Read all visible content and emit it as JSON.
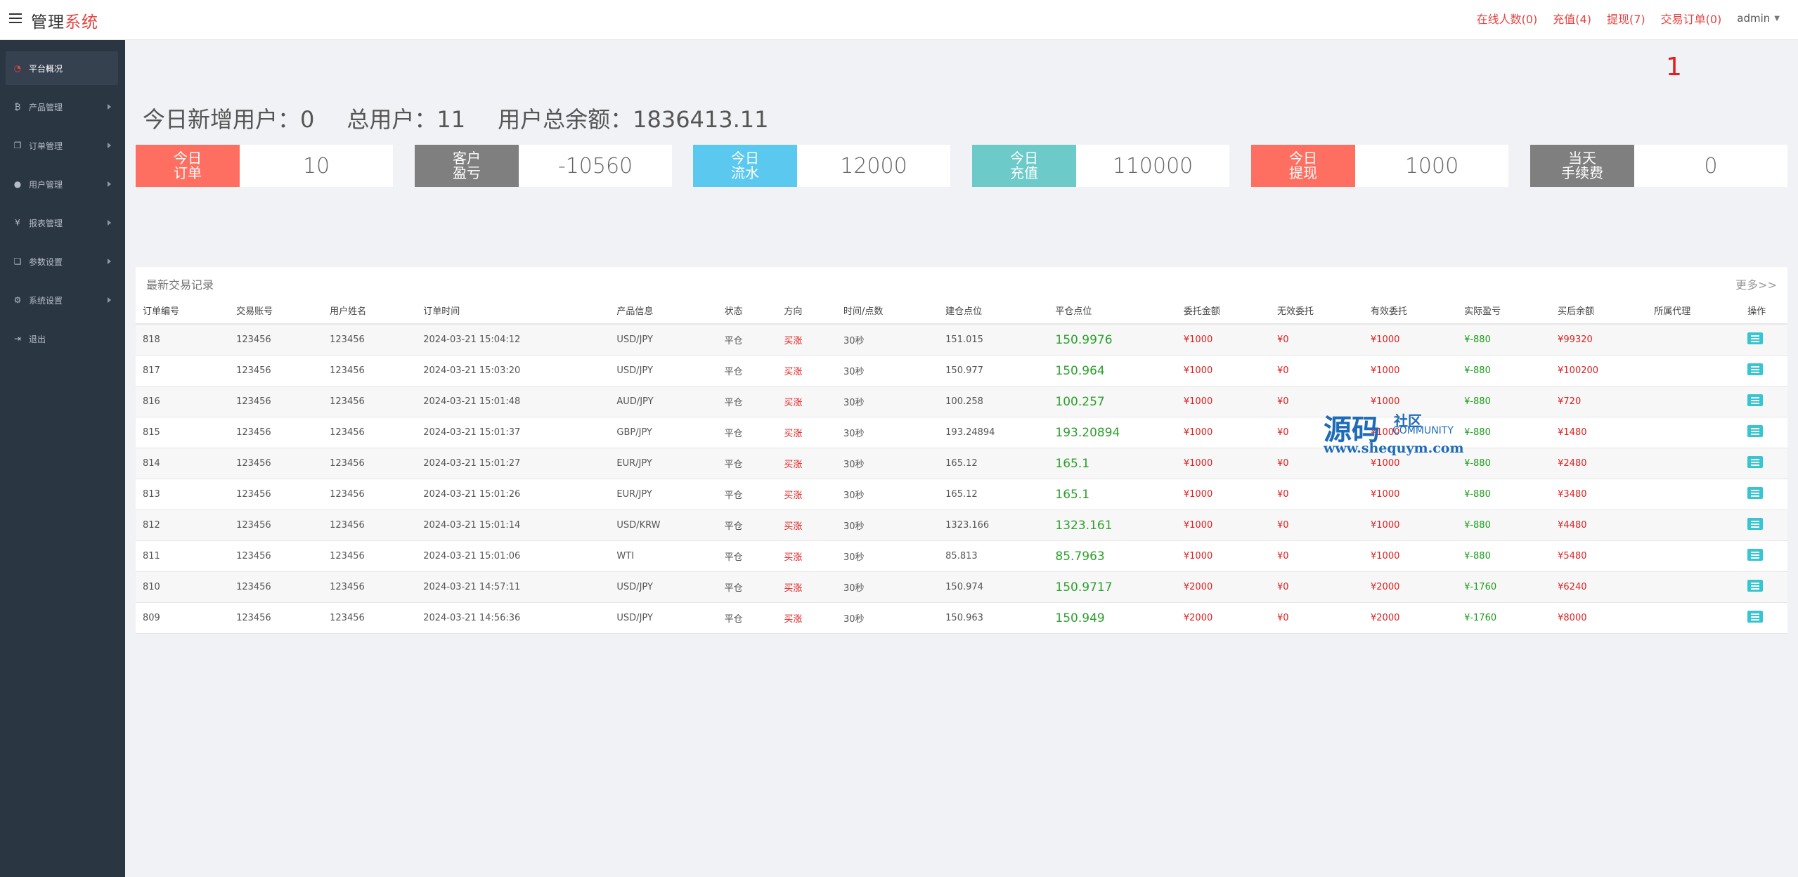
{
  "header": {
    "brand_main": "管理",
    "brand_accent": "系统",
    "links": {
      "online": "在线人数(0)",
      "recharge": "充值(4)",
      "withdraw": "提现(7)",
      "trade_orders": "交易订单(0)"
    },
    "user": "admin"
  },
  "sidebar": {
    "items": [
      {
        "label": "平台概况",
        "icon": "dashboard-icon"
      },
      {
        "label": "产品管理",
        "icon": "bitcoin-icon"
      },
      {
        "label": "订单管理",
        "icon": "copy-icon"
      },
      {
        "label": "用户管理",
        "icon": "user-icon"
      },
      {
        "label": "报表管理",
        "icon": "yen-icon"
      },
      {
        "label": "参数设置",
        "icon": "files-icon"
      },
      {
        "label": "系统设置",
        "icon": "cogs-icon"
      },
      {
        "label": "退出",
        "icon": "logout-icon"
      }
    ]
  },
  "badge_number": "1",
  "summary": {
    "today_new_users": "今日新增用户：0",
    "total_users": "总用户：11",
    "total_balance": "用户总余额：1836413.11"
  },
  "stats": [
    {
      "label1": "今日",
      "label2": "订单",
      "value": "10",
      "color": "#ff6f61"
    },
    {
      "label1": "客户",
      "label2": "盈亏",
      "value": "-10560",
      "color": "#7f7f7f"
    },
    {
      "label1": "今日",
      "label2": "流水",
      "value": "12000",
      "color": "#5bc8f0"
    },
    {
      "label1": "今日",
      "label2": "充值",
      "value": "110000",
      "color": "#6ccac9"
    },
    {
      "label1": "今日",
      "label2": "提现",
      "value": "1000",
      "color": "#ff6f61"
    },
    {
      "label1": "当天",
      "label2": "手续费",
      "value": "0",
      "color": "#7f7f7f"
    }
  ],
  "trades": {
    "title": "最新交易记录",
    "more": "更多>>",
    "columns": [
      "订单编号",
      "交易账号",
      "用户姓名",
      "订单时间",
      "产品信息",
      "状态",
      "方向",
      "时间/点数",
      "建仓点位",
      "平仓点位",
      "委托金额",
      "无效委托",
      "有效委托",
      "实际盈亏",
      "买后余额",
      "所属代理",
      "操作"
    ],
    "rows": [
      [
        "818",
        "123456",
        "123456",
        "2024-03-21 15:04:12",
        "USD/JPY",
        "平仓",
        "买涨",
        "30秒",
        "151.015",
        "150.9976",
        "¥1000",
        "¥0",
        "¥1000",
        "¥-880",
        "¥99320",
        ""
      ],
      [
        "817",
        "123456",
        "123456",
        "2024-03-21 15:03:20",
        "USD/JPY",
        "平仓",
        "买涨",
        "30秒",
        "150.977",
        "150.964",
        "¥1000",
        "¥0",
        "¥1000",
        "¥-880",
        "¥100200",
        ""
      ],
      [
        "816",
        "123456",
        "123456",
        "2024-03-21 15:01:48",
        "AUD/JPY",
        "平仓",
        "买涨",
        "30秒",
        "100.258",
        "100.257",
        "¥1000",
        "¥0",
        "¥1000",
        "¥-880",
        "¥720",
        ""
      ],
      [
        "815",
        "123456",
        "123456",
        "2024-03-21 15:01:37",
        "GBP/JPY",
        "平仓",
        "买涨",
        "30秒",
        "193.24894",
        "193.20894",
        "¥1000",
        "¥0",
        "¥1000",
        "¥-880",
        "¥1480",
        ""
      ],
      [
        "814",
        "123456",
        "123456",
        "2024-03-21 15:01:27",
        "EUR/JPY",
        "平仓",
        "买涨",
        "30秒",
        "165.12",
        "165.1",
        "¥1000",
        "¥0",
        "¥1000",
        "¥-880",
        "¥2480",
        ""
      ],
      [
        "813",
        "123456",
        "123456",
        "2024-03-21 15:01:26",
        "EUR/JPY",
        "平仓",
        "买涨",
        "30秒",
        "165.12",
        "165.1",
        "¥1000",
        "¥0",
        "¥1000",
        "¥-880",
        "¥3480",
        ""
      ],
      [
        "812",
        "123456",
        "123456",
        "2024-03-21 15:01:14",
        "USD/KRW",
        "平仓",
        "买涨",
        "30秒",
        "1323.166",
        "1323.161",
        "¥1000",
        "¥0",
        "¥1000",
        "¥-880",
        "¥4480",
        ""
      ],
      [
        "811",
        "123456",
        "123456",
        "2024-03-21 15:01:06",
        "WTI",
        "平仓",
        "买涨",
        "30秒",
        "85.813",
        "85.7963",
        "¥1000",
        "¥0",
        "¥1000",
        "¥-880",
        "¥5480",
        ""
      ],
      [
        "810",
        "123456",
        "123456",
        "2024-03-21 14:57:11",
        "USD/JPY",
        "平仓",
        "买涨",
        "30秒",
        "150.974",
        "150.9717",
        "¥2000",
        "¥0",
        "¥2000",
        "¥-1760",
        "¥6240",
        ""
      ],
      [
        "809",
        "123456",
        "123456",
        "2024-03-21 14:56:36",
        "USD/JPY",
        "平仓",
        "买涨",
        "30秒",
        "150.963",
        "150.949",
        "¥2000",
        "¥0",
        "¥2000",
        "¥-1760",
        "¥8000",
        ""
      ]
    ]
  },
  "watermark": {
    "big": "源码",
    "small1": "社区",
    "small2": "COMMUNITY",
    "url": "www.shequym.com"
  }
}
